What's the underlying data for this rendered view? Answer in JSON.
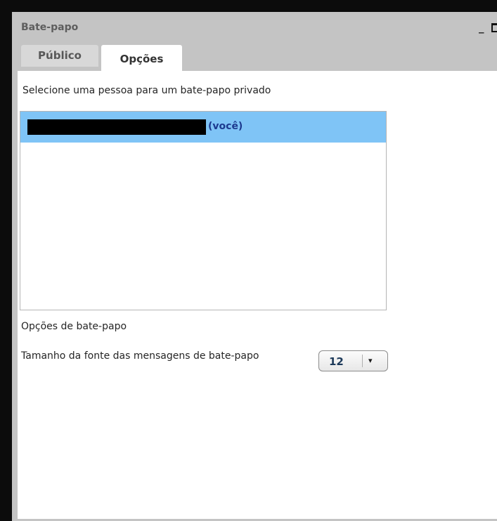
{
  "window": {
    "title": "Bate-papo",
    "minimize_glyph": "_",
    "maximize_icon": "maximize-icon"
  },
  "tabs": [
    {
      "label": "Público",
      "active": false
    },
    {
      "label": "Opções",
      "active": true
    }
  ],
  "private_chat": {
    "instruction": "Selecione uma pessoa para um bate-papo privado",
    "users": [
      {
        "name_redacted": true,
        "suffix": "(você)",
        "selected": true
      }
    ]
  },
  "options": {
    "heading": "Opções de bate-papo",
    "font_size_label": "Tamanho da fonte das mensagens de bate-papo",
    "font_size_value": "12",
    "dropdown_arrow": "▾"
  },
  "colors": {
    "selected_row": "#7fc4f6",
    "you_tag": "#1d3a8f",
    "panel_chrome": "#c4c4c4"
  }
}
